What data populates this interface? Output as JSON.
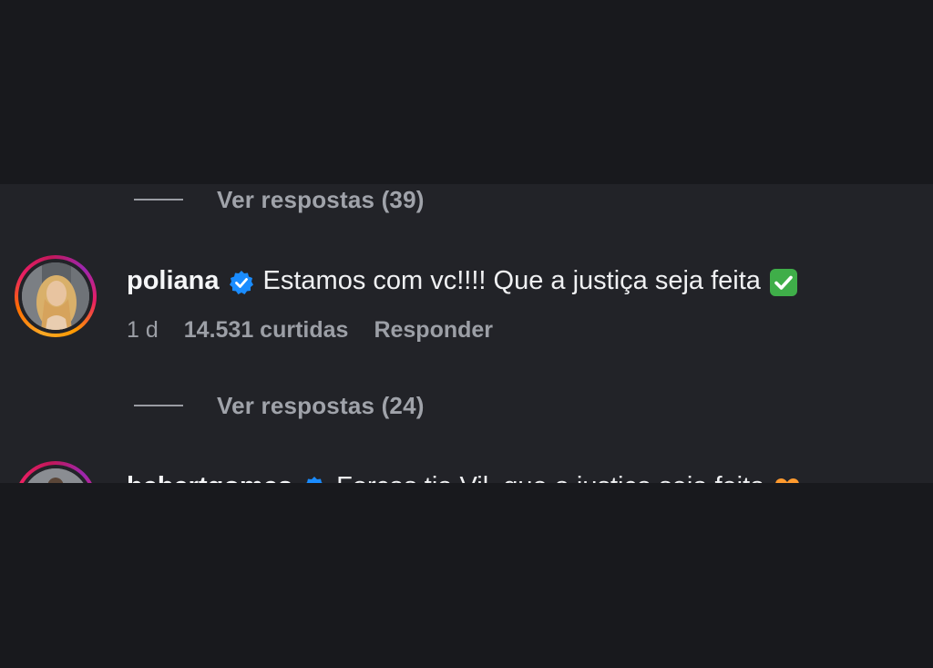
{
  "comments_thread": {
    "view_replies_1": {
      "label": "Ver respostas (39)"
    },
    "comment_1": {
      "username": "poliana",
      "text": "Estamos com vc!!!! Que a justiça seja feita",
      "emoji": "check-mark-emoji",
      "time": "1 d",
      "likes": "14.531 curtidas",
      "reply_label": "Responder",
      "verified": true
    },
    "view_replies_2": {
      "label": "Ver respostas (24)"
    },
    "comment_2": {
      "username": "hebertgomes",
      "text": "Forças tia Vil, que a justiça seja feita",
      "emoji": "orange-heart-emoji",
      "verified": true
    }
  },
  "colors": {
    "verified_badge": "#1a8cff",
    "panel_background": "#222328",
    "letterbox": "#18191d",
    "muted_text": "#9c9fa6",
    "primary_text": "#f2f3f5"
  }
}
